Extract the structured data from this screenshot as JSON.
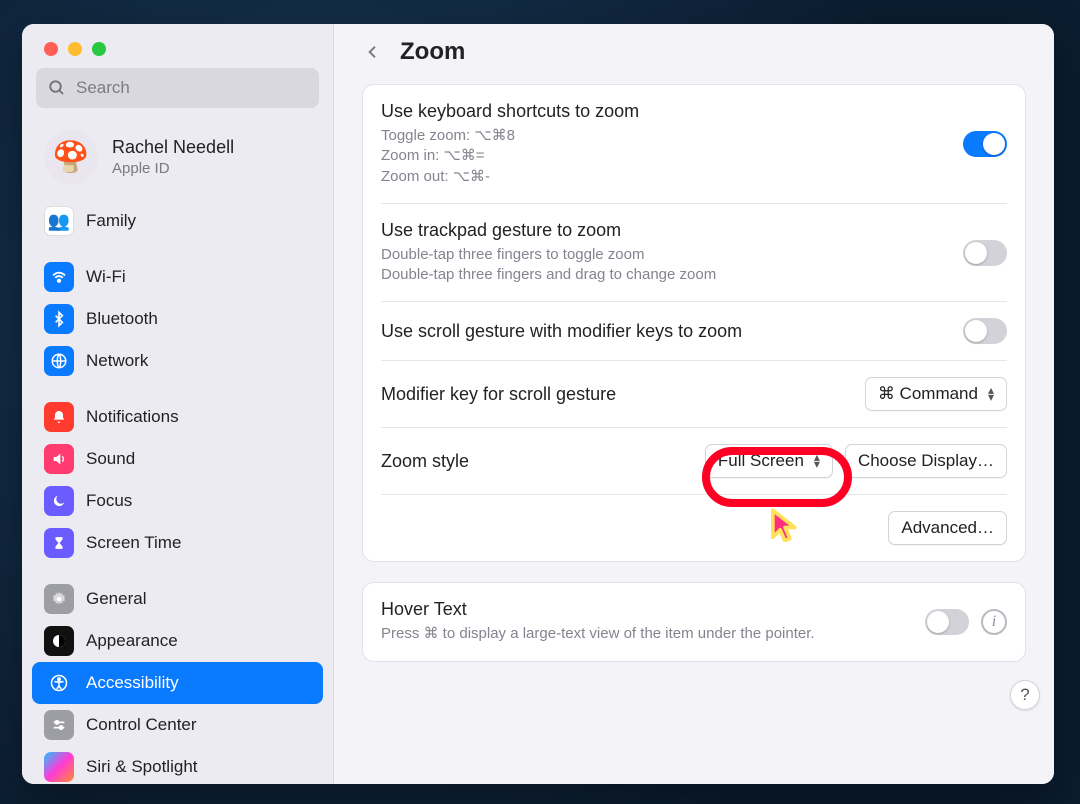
{
  "traffic": {
    "close": "close",
    "min": "minimize",
    "max": "maximize"
  },
  "search": {
    "placeholder": "Search"
  },
  "profile": {
    "name": "Rachel Needell",
    "sub": "Apple ID",
    "emoji": "🍄"
  },
  "sidebar": {
    "family": "Family",
    "wifi": "Wi-Fi",
    "bluetooth": "Bluetooth",
    "network": "Network",
    "notifications": "Notifications",
    "sound": "Sound",
    "focus": "Focus",
    "screentime": "Screen Time",
    "general": "General",
    "appearance": "Appearance",
    "accessibility": "Accessibility",
    "controlcenter": "Control Center",
    "siri": "Siri & Spotlight"
  },
  "header": {
    "title": "Zoom"
  },
  "rows": {
    "kb": {
      "label": "Use keyboard shortcuts to zoom",
      "d1": "Toggle zoom: ⌥⌘8",
      "d2": "Zoom in: ⌥⌘=",
      "d3": "Zoom out: ⌥⌘-",
      "on": true
    },
    "trackpad": {
      "label": "Use trackpad gesture to zoom",
      "d1": "Double-tap three fingers to toggle zoom",
      "d2": "Double-tap three fingers and drag to change zoom",
      "on": false
    },
    "scrollmod": {
      "label": "Use scroll gesture with modifier keys to zoom",
      "on": false
    },
    "modkey": {
      "label": "Modifier key for scroll gesture",
      "value": "⌘ Command"
    },
    "style": {
      "label": "Zoom style",
      "value": "Full Screen",
      "choose": "Choose Display…"
    },
    "advanced": "Advanced…",
    "hover": {
      "label": "Hover Text",
      "desc": "Press ⌘ to display a large-text view of the item under the pointer.",
      "on": false
    }
  },
  "help": "?"
}
